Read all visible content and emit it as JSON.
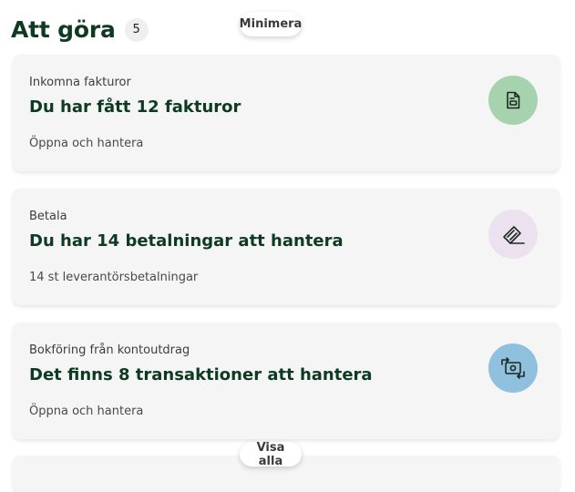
{
  "header": {
    "title": "Att göra",
    "count": "5"
  },
  "controls": {
    "minimize_label": "Minimera",
    "show_all_label": "Visa alla"
  },
  "cards": [
    {
      "subtitle": "Inkomna fakturor",
      "heading": "Du har fått 12 fakturor",
      "detail": "Öppna och hantera",
      "icon": "invoice-icon",
      "icon_bg": "#a6d3ad"
    },
    {
      "subtitle": "Betala",
      "heading": "Du har 14 betalningar att hantera",
      "detail": "14 st leverantörsbetalningar",
      "icon": "payment-icon",
      "icon_bg": "#ece1ee"
    },
    {
      "subtitle": "Bokföring från kontoutdrag",
      "heading": "Det finns 8 transaktioner att hantera",
      "detail": "Öppna och hantera",
      "icon": "transactions-icon",
      "icon_bg": "#8fc0de"
    }
  ]
}
